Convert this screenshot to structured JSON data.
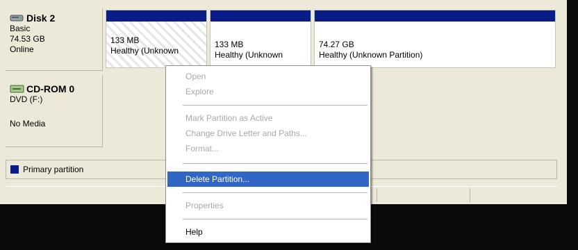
{
  "disk2": {
    "name": "Disk 2",
    "type": "Basic",
    "size": "74.53 GB",
    "status": "Online",
    "partitions": [
      {
        "size": "133 MB",
        "status": "Healthy (Unknown"
      },
      {
        "size": "133 MB",
        "status": "Healthy (Unknown"
      },
      {
        "size": "74.27 GB",
        "status": "Healthy (Unknown Partition)"
      }
    ]
  },
  "cdrom": {
    "name": "CD-ROM 0",
    "drive": "DVD (F:)",
    "media": "No Media"
  },
  "legend": {
    "label": "Primary partition",
    "color": "#0a1c85"
  },
  "context_menu": {
    "items": [
      {
        "label": "Open",
        "enabled": false
      },
      {
        "label": "Explore",
        "enabled": false
      },
      {
        "label": "Mark Partition as Active",
        "enabled": false
      },
      {
        "label": "Change Drive Letter and Paths...",
        "enabled": false
      },
      {
        "label": "Format...",
        "enabled": false
      },
      {
        "label": "Delete Partition...",
        "enabled": true,
        "selected": true
      },
      {
        "label": "Properties",
        "enabled": false
      },
      {
        "label": "Help",
        "enabled": true
      }
    ],
    "highlight_color": "#3166c5"
  },
  "icons": {
    "disk": "hard-disk-icon",
    "cdrom": "cdrom-icon"
  }
}
